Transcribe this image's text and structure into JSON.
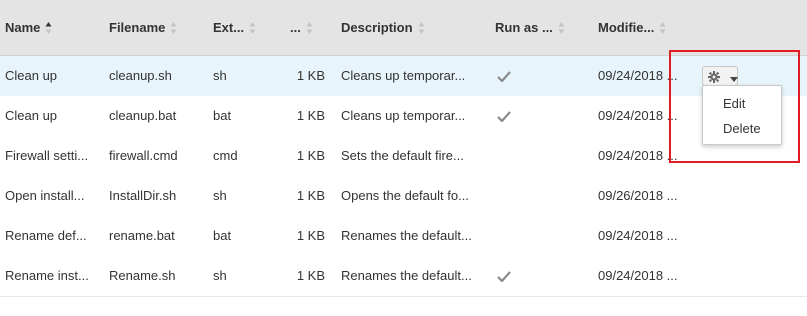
{
  "columns": [
    {
      "label": "Name"
    },
    {
      "label": "Filename"
    },
    {
      "label": "Ext..."
    },
    {
      "label": "..."
    },
    {
      "label": "Description"
    },
    {
      "label": "Run as ..."
    },
    {
      "label": "Modifie..."
    }
  ],
  "rows": [
    {
      "name": "Clean up",
      "filename": "cleanup.sh",
      "ext": "sh",
      "size": "1 KB",
      "description": "Cleans up temporar...",
      "run_as": true,
      "modified": "09/24/2018 ..."
    },
    {
      "name": "Clean up",
      "filename": "cleanup.bat",
      "ext": "bat",
      "size": "1 KB",
      "description": "Cleans up temporar...",
      "run_as": true,
      "modified": "09/24/2018 ..."
    },
    {
      "name": "Firewall setti...",
      "filename": "firewall.cmd",
      "ext": "cmd",
      "size": "1 KB",
      "description": "Sets the default fire...",
      "run_as": false,
      "modified": "09/24/2018 ..."
    },
    {
      "name": "Open install...",
      "filename": "InstallDir.sh",
      "ext": "sh",
      "size": "1 KB",
      "description": "Opens the default fo...",
      "run_as": false,
      "modified": "09/26/2018 ..."
    },
    {
      "name": "Rename def...",
      "filename": "rename.bat",
      "ext": "bat",
      "size": "1 KB",
      "description": "Renames the default...",
      "run_as": false,
      "modified": "09/24/2018 ..."
    },
    {
      "name": "Rename inst...",
      "filename": "Rename.sh",
      "ext": "sh",
      "size": "1 KB",
      "description": "Renames the default...",
      "run_as": true,
      "modified": "09/24/2018 ..."
    }
  ],
  "action_menu": {
    "button_icon": "gear-icon",
    "items": [
      {
        "label": "Edit"
      },
      {
        "label": "Delete"
      }
    ]
  },
  "colors": {
    "header_bg": "#e4e4e4",
    "selected_row_bg": "#e8f4fb",
    "highlight_border": "#e01b24",
    "check_color": "#8a8a8a"
  }
}
